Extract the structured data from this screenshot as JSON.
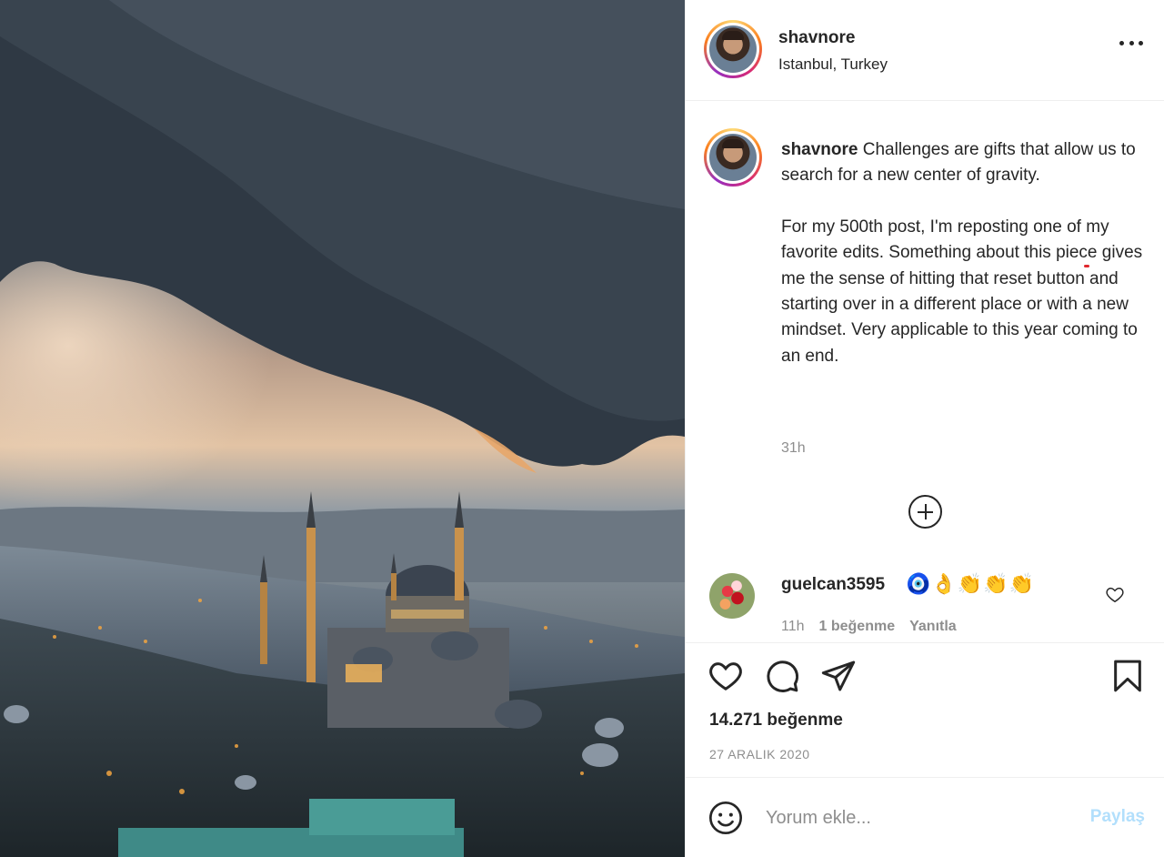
{
  "post": {
    "username": "shavnore",
    "location": "Istanbul, Turkey",
    "caption": {
      "username": "shavnore",
      "line1": " Challenges are gifts that allow us to search for a new center of gravity.",
      "p2_before": "For my 500th post, I'm reposting one of ",
      "p2_highlight": "my favorite edits",
      "p2_after": ". Something about this piece gives me the sense of hitting that reset button and starting over in a different place or with a new mindset. Very applicable to this year coming to an end."
    },
    "time": "31h",
    "likes_label": "14.271 beğenme",
    "date": "27 ARALIK 2020"
  },
  "comment": {
    "username": "guelcan3595",
    "text": "🧿👌👏👏👏",
    "time": "11h",
    "likes": "1 beğenme",
    "reply": "Yanıtla"
  },
  "add_comment": {
    "placeholder": "Yorum ekle...",
    "post_label": "Paylaş"
  },
  "icons": {
    "more": "more-options-icon",
    "load_more": "plus-circle-icon",
    "like": "heart-icon",
    "comment": "comment-bubble-icon",
    "share": "paper-plane-icon",
    "save": "bookmark-icon",
    "emoji": "smiley-icon"
  },
  "colors": {
    "story_ring": [
      "#feda75",
      "#fa7e1e",
      "#d62976",
      "#962fbf"
    ],
    "post_button_disabled": "#b2dffc",
    "annotation_underline": "#e0282e"
  }
}
